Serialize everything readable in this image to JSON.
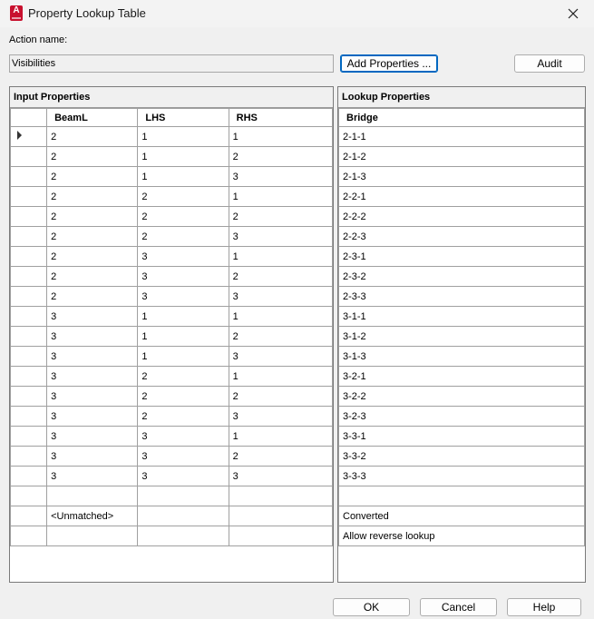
{
  "window": {
    "title": "Property Lookup Table",
    "app_icon_letter": "A"
  },
  "action": {
    "label": "Action name:",
    "value": "Visibilities"
  },
  "buttons": {
    "add_properties": "Add Properties ...",
    "audit": "Audit",
    "ok": "OK",
    "cancel": "Cancel",
    "help": "Help"
  },
  "input_panel": {
    "title": "Input Properties",
    "columns": [
      "BeamL",
      "LHS",
      "RHS"
    ],
    "rows": [
      [
        "2",
        "1",
        "1"
      ],
      [
        "2",
        "1",
        "2"
      ],
      [
        "2",
        "1",
        "3"
      ],
      [
        "2",
        "2",
        "1"
      ],
      [
        "2",
        "2",
        "2"
      ],
      [
        "2",
        "2",
        "3"
      ],
      [
        "2",
        "3",
        "1"
      ],
      [
        "2",
        "3",
        "2"
      ],
      [
        "2",
        "3",
        "3"
      ],
      [
        "3",
        "1",
        "1"
      ],
      [
        "3",
        "1",
        "2"
      ],
      [
        "3",
        "1",
        "3"
      ],
      [
        "3",
        "2",
        "1"
      ],
      [
        "3",
        "2",
        "2"
      ],
      [
        "3",
        "2",
        "3"
      ],
      [
        "3",
        "3",
        "1"
      ],
      [
        "3",
        "3",
        "2"
      ],
      [
        "3",
        "3",
        "3"
      ],
      [
        "",
        "",
        ""
      ],
      [
        "<Unmatched>",
        "",
        ""
      ],
      [
        "",
        "",
        ""
      ]
    ]
  },
  "lookup_panel": {
    "title": "Lookup Properties",
    "columns": [
      "Bridge"
    ],
    "rows": [
      "2-1-1",
      "2-1-2",
      "2-1-3",
      "2-2-1",
      "2-2-2",
      "2-2-3",
      "2-3-1",
      "2-3-2",
      "2-3-3",
      "3-1-1",
      "3-1-2",
      "3-1-3",
      "3-2-1",
      "3-2-2",
      "3-2-3",
      "3-3-1",
      "3-3-2",
      "3-3-3",
      "",
      "Converted",
      "Allow reverse lookup"
    ]
  }
}
